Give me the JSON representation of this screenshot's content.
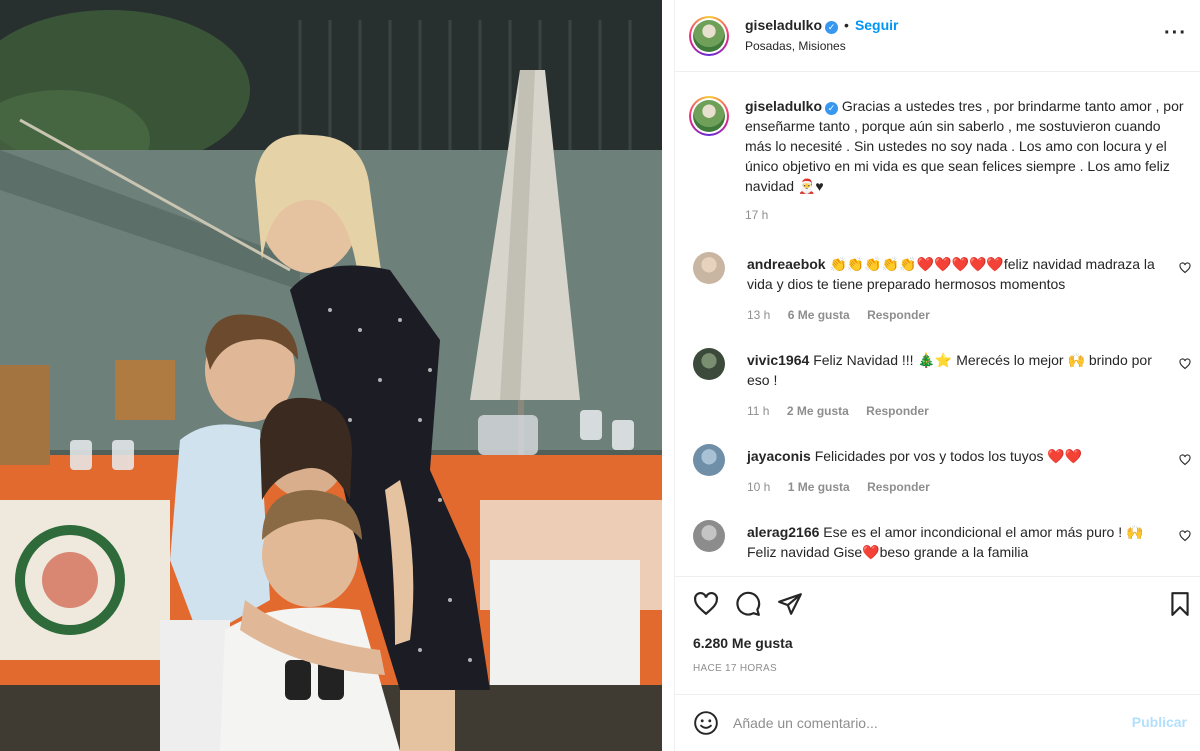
{
  "post": {
    "username": "giseladulko",
    "follow_label": "Seguir",
    "location": "Posadas, Misiones",
    "more_icon": "more-horizontal-icon"
  },
  "caption": {
    "username": "giseladulko",
    "text": "Gracias a ustedes tres , por brindarme tanto amor , por enseñarme tanto , porque aún sin saberlo , me sostuvieron cuando más lo necesité . Sin ustedes no soy nada . Los amo con locura y el único objetivo en mi vida es que sean felices siempre . Los amo feliz navidad",
    "emoji": "🎅♥",
    "time": "17 h"
  },
  "comments": [
    {
      "username": "andreaebok",
      "emojis": "👏👏👏👏👏❤️❤️❤️❤️❤️",
      "text": "feliz navidad madraza la vida y dios te tiene preparado hermosos momentos",
      "time": "13 h",
      "likes": "6 Me gusta",
      "reply": "Responder",
      "avatar_color": "#c9b6a2"
    },
    {
      "username": "vivic1964",
      "text_a": "Feliz Navidad !!!",
      "emoji_a": "🎄⭐",
      "text_b": "Merecés lo mejor",
      "emoji_b": "🙌",
      "text_c": "brindo por eso !",
      "time": "11 h",
      "likes": "2 Me gusta",
      "reply": "Responder",
      "avatar_color": "#3b4a3a"
    },
    {
      "username": "jayaconis",
      "text": "Felicidades por vos y todos los tuyos",
      "emojis": "❤️❤️",
      "time": "10 h",
      "likes": "1 Me gusta",
      "reply": "Responder",
      "avatar_color": "#6f8fa8"
    },
    {
      "username": "alerag2166",
      "text_a": "Ese es el amor incondicional el amor más puro !",
      "emoji_a": "🙌",
      "text_b": "Feliz navidad Gise",
      "emoji_b": "❤️",
      "text_c": "beso grande a la familia",
      "avatar_color": "#8c8c8c"
    }
  ],
  "actions": {
    "likes": "6.280 Me gusta",
    "ago": "HACE 17 HORAS"
  },
  "add_comment": {
    "placeholder": "Añade un comentario...",
    "publish": "Publicar"
  }
}
